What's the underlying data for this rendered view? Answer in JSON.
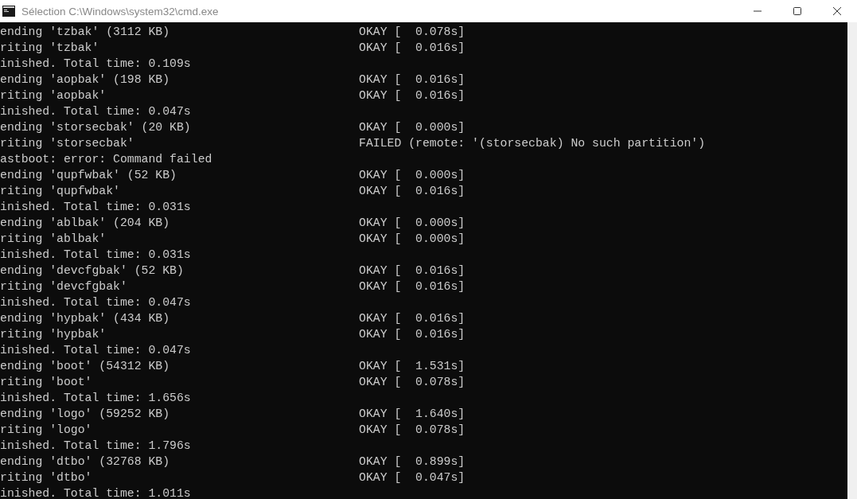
{
  "window": {
    "title": "Sélection C:\\Windows\\system32\\cmd.exe"
  },
  "console": {
    "lines": [
      {
        "left": "ending 'tzbak' (3112 KB)",
        "right": "OKAY [  0.078s]"
      },
      {
        "left": "riting 'tzbak'",
        "right": "OKAY [  0.016s]"
      },
      {
        "left": "inished. Total time: 0.109s"
      },
      {
        "left": "ending 'aopbak' (198 KB)",
        "right": "OKAY [  0.016s]"
      },
      {
        "left": "riting 'aopbak'",
        "right": "OKAY [  0.016s]"
      },
      {
        "left": "inished. Total time: 0.047s"
      },
      {
        "left": "ending 'storsecbak' (20 KB)",
        "right": "OKAY [  0.000s]"
      },
      {
        "left": "riting 'storsecbak'",
        "right": "FAILED (remote: '(storsecbak) No such partition')"
      },
      {
        "left": "astboot: error: Command failed"
      },
      {
        "left": "ending 'qupfwbak' (52 KB)",
        "right": "OKAY [  0.000s]"
      },
      {
        "left": "riting 'qupfwbak'",
        "right": "OKAY [  0.016s]"
      },
      {
        "left": "inished. Total time: 0.031s"
      },
      {
        "left": "ending 'ablbak' (204 KB)",
        "right": "OKAY [  0.000s]"
      },
      {
        "left": "riting 'ablbak'",
        "right": "OKAY [  0.000s]"
      },
      {
        "left": "inished. Total time: 0.031s"
      },
      {
        "left": "ending 'devcfgbak' (52 KB)",
        "right": "OKAY [  0.016s]"
      },
      {
        "left": "riting 'devcfgbak'",
        "right": "OKAY [  0.016s]"
      },
      {
        "left": "inished. Total time: 0.047s"
      },
      {
        "left": "ending 'hypbak' (434 KB)",
        "right": "OKAY [  0.016s]"
      },
      {
        "left": "riting 'hypbak'",
        "right": "OKAY [  0.016s]"
      },
      {
        "left": "inished. Total time: 0.047s"
      },
      {
        "left": "ending 'boot' (54312 KB)",
        "right": "OKAY [  1.531s]"
      },
      {
        "left": "riting 'boot'",
        "right": "OKAY [  0.078s]"
      },
      {
        "left": "inished. Total time: 1.656s"
      },
      {
        "left": "ending 'logo' (59252 KB)",
        "right": "OKAY [  1.640s]"
      },
      {
        "left": "riting 'logo'",
        "right": "OKAY [  0.078s]"
      },
      {
        "left": "inished. Total time: 1.796s"
      },
      {
        "left": "ending 'dtbo' (32768 KB)",
        "right": "OKAY [  0.899s]"
      },
      {
        "left": "riting 'dtbo'",
        "right": "OKAY [  0.047s]"
      },
      {
        "left": "inished. Total time: 1.011s"
      }
    ]
  }
}
